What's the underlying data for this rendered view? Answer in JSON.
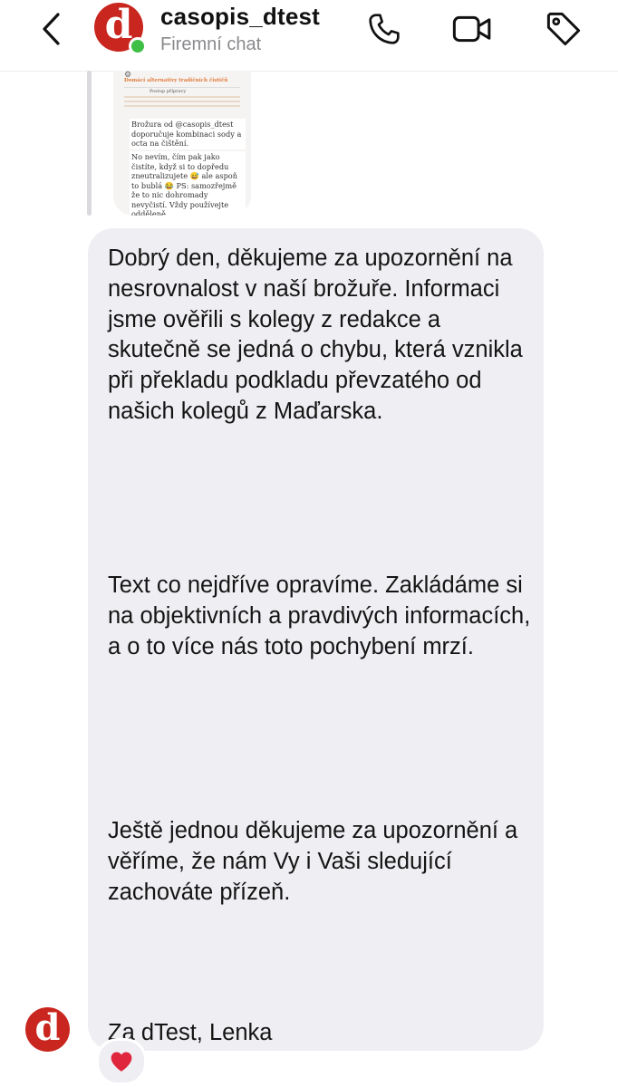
{
  "header": {
    "chat_name": "casopis_dtest",
    "subtitle": "Firemní chat",
    "avatar_letter": "d",
    "online": true,
    "icons": {
      "back": "chevron-left-icon",
      "call": "phone-icon",
      "video": "video-camera-icon",
      "tag": "tag-icon"
    }
  },
  "replied_image": {
    "title": "Domácí alternativy tradičních čističů",
    "table_header": "Postup přípravy",
    "caption_1": "Brožura od @casopis_dtest doporučuje kombinaci sody a octa na čištění.",
    "caption_2": "No nevím, čím pak jako čistíte, když si to dopředu zneutralizujete 😅 ale aspoň to bublá 😂 PS: samozřejmě že to nic dohromady nevyčistí. Vždy používejte odděleně."
  },
  "message": {
    "paragraph_1": "Dobrý den, děkujeme za upozornění na nesrovnalost v naší brožuře. Informaci jsme ověřili s kolegy z redakce a skutečně se jedná o chybu, která vznikla při překladu podkladu převzatého od našich kolegů z Maďarska.",
    "paragraph_2": "Text co nejdříve opravíme. Zakládáme si na objektivních a pravdivých informacích, a o to více nás toto pochybení mrzí.",
    "paragraph_3": "Ještě jednou děkujeme za upozornění a věříme, že nám Vy i Vaši sledující zachováte přízeň.",
    "signature": "Za dTest, Lenka"
  },
  "sender": {
    "avatar_letter": "d"
  },
  "reaction": {
    "emoji": "❤️"
  },
  "colors": {
    "brand_red": "#c8261e",
    "online_green": "#3fbf45",
    "bubble_bg": "#efeff3",
    "subtitle_gray": "#8a8a8e"
  }
}
